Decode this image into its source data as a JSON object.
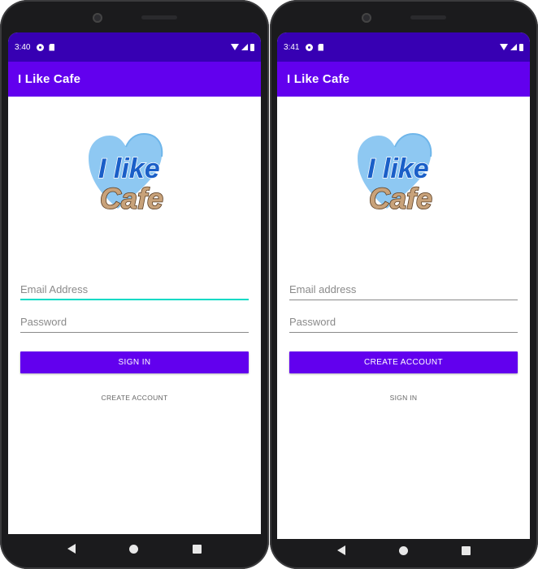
{
  "left_phone": {
    "status": {
      "time": "3:40"
    },
    "app_title": "I Like Cafe",
    "logo_text": {
      "top": "I like",
      "bottom": "Cafe"
    },
    "email_field": {
      "label": "Email Address"
    },
    "password_field": {
      "label": "Password"
    },
    "primary_button": "SIGN IN",
    "secondary_button": "CREATE ACCOUNT"
  },
  "right_phone": {
    "status": {
      "time": "3:41"
    },
    "app_title": "I Like Cafe",
    "logo_text": {
      "top": "I like",
      "bottom": "Cafe"
    },
    "email_field": {
      "label": "Email address"
    },
    "password_field": {
      "label": "Password"
    },
    "primary_button": "CREATE ACCOUNT",
    "secondary_button": "SIGN IN"
  },
  "colors": {
    "status_bar": "#3700b3",
    "app_bar": "#6200ee",
    "accent": "#03dac5",
    "logo_heart": "#8ec8f2",
    "logo_text_blue": "#1a5fc8",
    "logo_text_tan": "#c8a27a"
  },
  "icons": {
    "status": [
      "notification-icon",
      "sd-card-icon",
      "wifi-icon",
      "signal-icon",
      "battery-icon"
    ],
    "nav": [
      "back-icon",
      "home-icon",
      "recents-icon"
    ]
  }
}
